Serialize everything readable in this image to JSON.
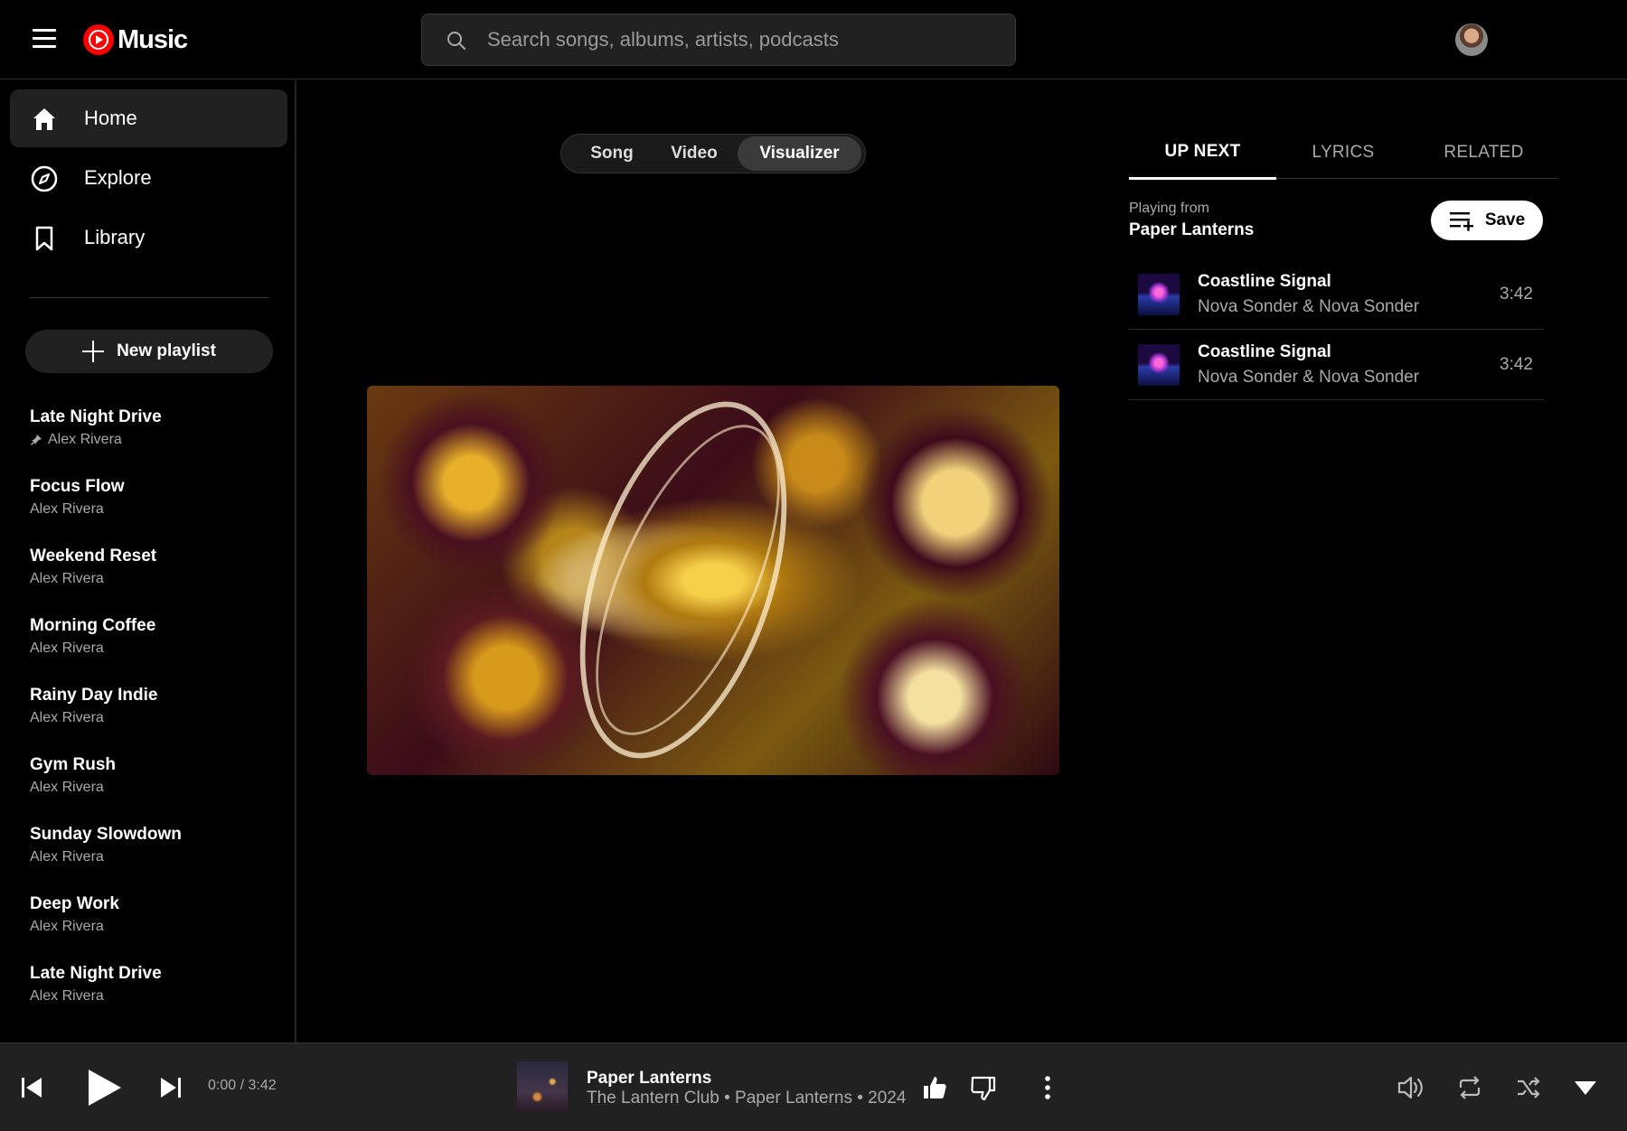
{
  "header": {
    "logo_text": "Music",
    "search": {
      "placeholder": "Search songs, albums, artists, podcasts",
      "value": ""
    }
  },
  "sidebar": {
    "nav": [
      {
        "label": "Home",
        "icon": "home-icon",
        "active": true
      },
      {
        "label": "Explore",
        "icon": "compass-icon",
        "active": false
      },
      {
        "label": "Library",
        "icon": "bookmark-icon",
        "active": false
      }
    ],
    "new_playlist_label": "New playlist",
    "playlists": [
      {
        "name": "Late Night Drive",
        "owner": "Alex Rivera",
        "pinned": true
      },
      {
        "name": "Focus Flow",
        "owner": "Alex Rivera",
        "pinned": false
      },
      {
        "name": "Weekend Reset",
        "owner": "Alex Rivera",
        "pinned": false
      },
      {
        "name": "Morning Coffee",
        "owner": "Alex Rivera",
        "pinned": false
      },
      {
        "name": "Rainy Day Indie",
        "owner": "Alex Rivera",
        "pinned": false
      },
      {
        "name": "Gym Rush",
        "owner": "Alex Rivera",
        "pinned": false
      },
      {
        "name": "Sunday Slowdown",
        "owner": "Alex Rivera",
        "pinned": false
      },
      {
        "name": "Deep Work",
        "owner": "Alex Rivera",
        "pinned": false
      },
      {
        "name": "Late Night Drive",
        "owner": "Alex Rivera",
        "pinned": false
      }
    ]
  },
  "main": {
    "view_toggle": [
      {
        "label": "Song",
        "active": false
      },
      {
        "label": "Video",
        "active": false
      },
      {
        "label": "Visualizer",
        "active": true
      }
    ]
  },
  "panel": {
    "tabs": [
      {
        "label": "UP NEXT",
        "active": true
      },
      {
        "label": "LYRICS",
        "active": false
      },
      {
        "label": "RELATED",
        "active": false
      }
    ],
    "playing_from_label": "Playing from",
    "playing_from_name": "Paper Lanterns",
    "save_label": "Save",
    "queue": [
      {
        "title": "Coastline Signal",
        "artist": "Nova Sonder & Nova Sonder",
        "duration": "3:42"
      },
      {
        "title": "Coastline Signal",
        "artist": "Nova Sonder & Nova Sonder",
        "duration": "3:42"
      }
    ]
  },
  "player": {
    "time": "0:00 / 3:42",
    "title": "Paper Lanterns",
    "subtitle": "The Lantern Club • Paper Lanterns • 2024"
  },
  "colors": {
    "background": "#000000",
    "surface": "#212121",
    "accent": "#ff0000",
    "text_secondary": "#aaaaaa"
  }
}
